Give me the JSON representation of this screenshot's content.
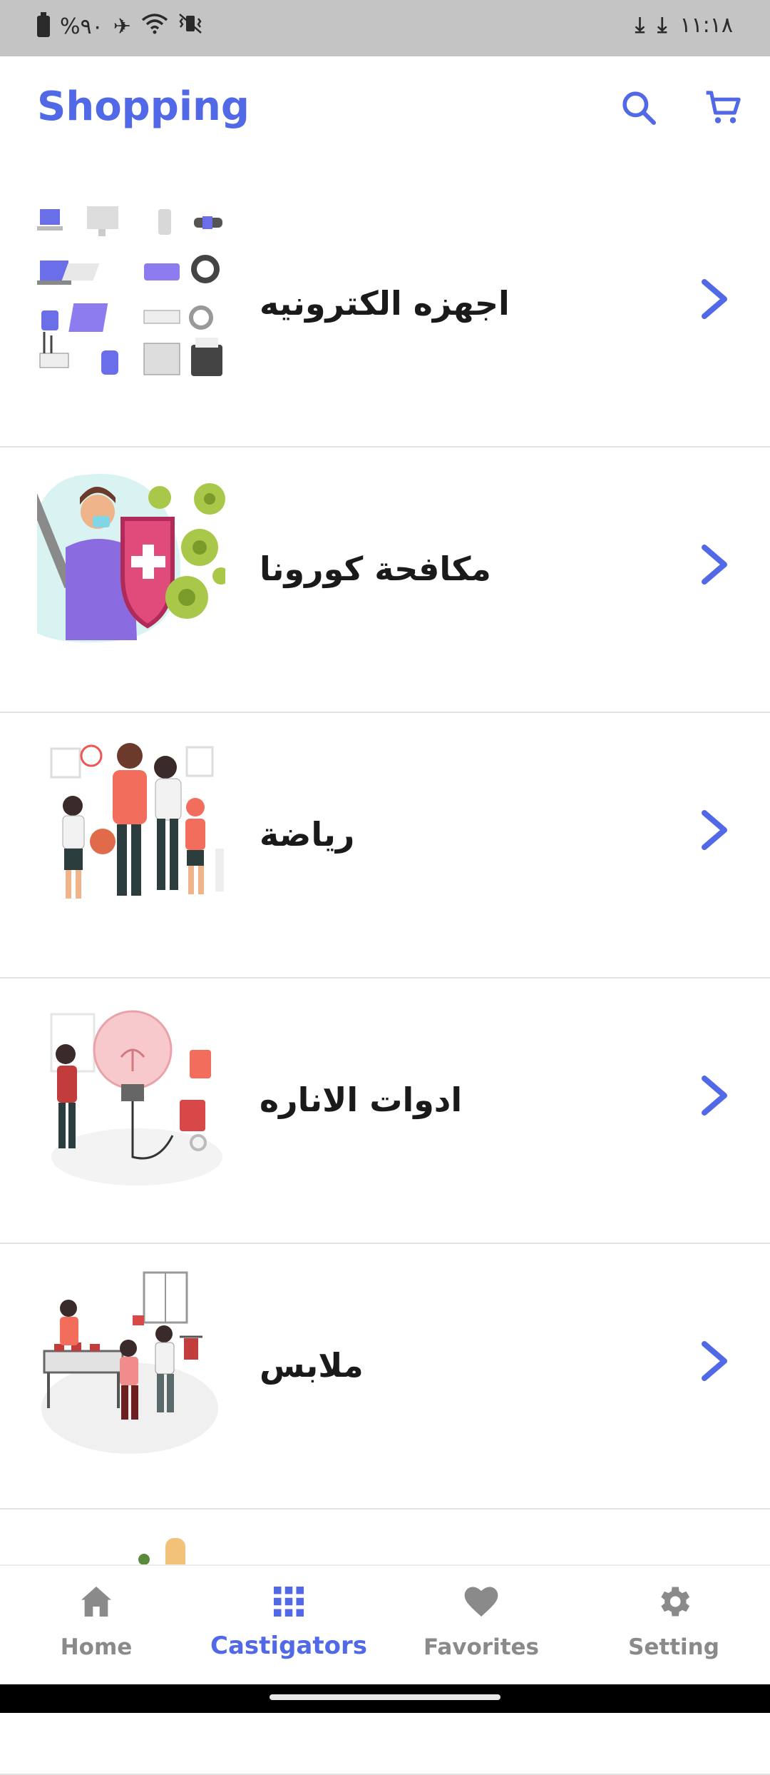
{
  "status_bar": {
    "battery_percent": "%٩٠",
    "time": "١١:١٨",
    "icons": [
      "battery-icon",
      "airplane-icon",
      "wifi-icon",
      "vibrate-icon",
      "download-icon",
      "download-icon"
    ]
  },
  "app_bar": {
    "title": "Shopping",
    "actions": [
      "search-icon",
      "cart-icon"
    ]
  },
  "categories": [
    {
      "label": "اجهزه الكترونيه",
      "image": "electronics-illustration"
    },
    {
      "label": "مكافحة كورونا",
      "image": "corona-fight-illustration"
    },
    {
      "label": "رياضة",
      "image": "sports-family-illustration"
    },
    {
      "label": "ادوات الاناره",
      "image": "lighting-illustration"
    },
    {
      "label": "ملابس",
      "image": "clothes-shop-illustration"
    }
  ],
  "bottom_nav": {
    "items": [
      {
        "label": "Home",
        "icon": "home-icon",
        "active": false
      },
      {
        "label": "Castigators",
        "icon": "grid-icon",
        "active": true
      },
      {
        "label": "Favorites",
        "icon": "heart-icon",
        "active": false
      },
      {
        "label": "Setting",
        "icon": "gear-icon",
        "active": false
      }
    ]
  },
  "colors": {
    "accent": "#5169e6",
    "inactive": "#8a8a8a",
    "status_bar_bg": "#c4c4c4",
    "divider": "#e3e3e3"
  }
}
